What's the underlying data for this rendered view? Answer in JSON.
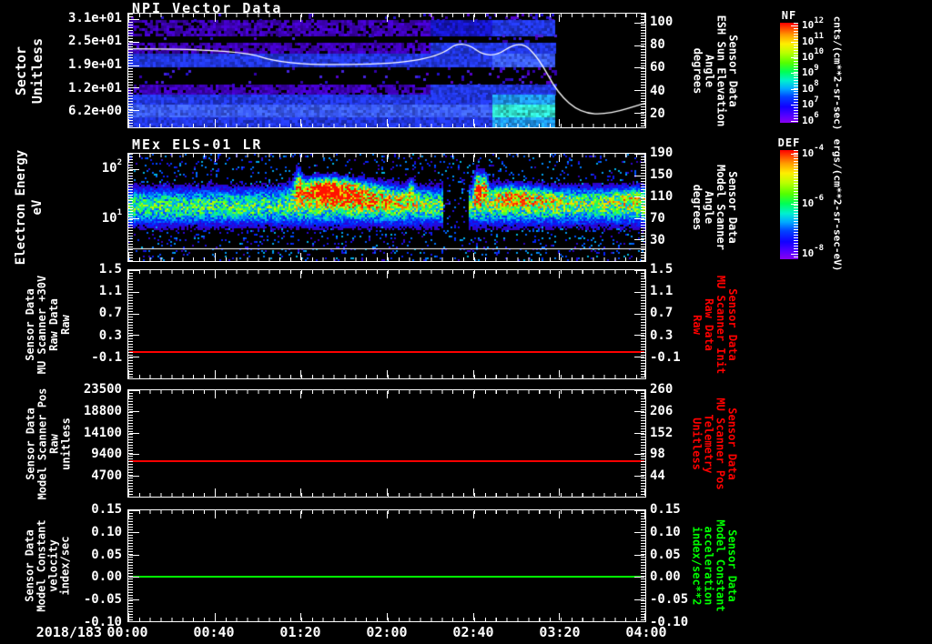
{
  "app": {
    "background": "#000000",
    "text_color": "#ffffff"
  },
  "x_axis": {
    "date_label": "2018/183",
    "tick_labels": [
      "00:00",
      "00:40",
      "01:20",
      "02:00",
      "02:40",
      "03:20",
      "04:00"
    ],
    "minor_ticks_per_major": 8
  },
  "chart_data": {
    "type": "heatmap",
    "description": "Five stacked time-series panels: two spectrograms with colorbars and three constant-value line plots, time axis 2018/183 00:00 to 04:00",
    "panels": [
      {
        "id": "npi",
        "type": "spectrogram",
        "title": "NPI Vector Data",
        "ylabel": "Sector\nUnitless",
        "left_ticks": {
          "labels": [
            "3.1e+01",
            "2.5e+01",
            "1.9e+01",
            "1.2e+01",
            "6.2e+00"
          ],
          "fracs": [
            0.048,
            0.246,
            0.452,
            0.651,
            0.849
          ]
        },
        "right_ticks": {
          "labels": [
            "100",
            "80",
            "60",
            "40",
            "20"
          ],
          "fracs": [
            0.079,
            0.278,
            0.476,
            0.675,
            0.873
          ]
        },
        "right_label": "Sensor Data\nESH Sun Elevation\nAngle\ndegrees",
        "right_label_color": "#ffffff",
        "data_end_frac": 0.825,
        "palette": {
          "purple": "#3c00b4",
          "bdark": "#1515be",
          "blue": "#2136e0",
          "bbright": "#3b5cff",
          "cblue": "#1e96f0",
          "cyan": "#2fd8c4",
          "speck_colors": [
            "#5500cc",
            "#3300aa",
            "#2211cc",
            "#4422dd"
          ]
        },
        "rows": [
          {
            "y0": 0.0,
            "y1": 0.055,
            "segs": [
              [
                "speck",
                0,
                0.825
              ]
            ]
          },
          {
            "y0": 0.055,
            "y1": 0.185,
            "segs": [
              [
                "purple",
                0,
                0.585
              ],
              [
                "bdark",
                0.585,
                0.705
              ],
              [
                "blue",
                0.705,
                0.825
              ]
            ]
          },
          {
            "y0": 0.185,
            "y1": 0.255,
            "segs": [
              [
                "speck",
                0,
                0.825
              ]
            ]
          },
          {
            "y0": 0.255,
            "y1": 0.355,
            "segs": [
              [
                "purple",
                0,
                0.585
              ],
              [
                "blue",
                0.585,
                0.825
              ]
            ]
          },
          {
            "y0": 0.355,
            "y1": 0.475,
            "segs": [
              [
                "blue",
                0,
                0.705
              ],
              [
                "bbright",
                0.705,
                0.825
              ]
            ]
          },
          {
            "y0": 0.475,
            "y1": 0.625,
            "segs": [
              [
                "speck",
                0,
                0.825
              ]
            ]
          },
          {
            "y0": 0.625,
            "y1": 0.715,
            "segs": [
              [
                "purple",
                0,
                0.585
              ],
              [
                "blue",
                0.585,
                0.825
              ]
            ]
          },
          {
            "y0": 0.715,
            "y1": 0.8,
            "segs": [
              [
                "blue",
                0,
                0.705
              ],
              [
                "cblue",
                0.705,
                0.825
              ]
            ]
          },
          {
            "y0": 0.8,
            "y1": 0.915,
            "segs": [
              [
                "bbright",
                0,
                0.705
              ],
              [
                "cyan",
                0.705,
                0.825
              ]
            ]
          },
          {
            "y0": 0.915,
            "y1": 1.0,
            "segs": [
              [
                "blue",
                0,
                0.705
              ],
              [
                "cblue",
                0.705,
                0.825
              ]
            ]
          }
        ],
        "overlay_line": {
          "color": "#ffffff",
          "axis": "right",
          "scale": {
            "v_at_frac0": 108,
            "v_span": 100.5
          },
          "points_xv": [
            [
              0,
              77
            ],
            [
              0.21,
              77
            ],
            [
              0.3,
              63
            ],
            [
              0.5,
              63
            ],
            [
              0.6,
              70
            ],
            [
              0.645,
              85
            ],
            [
              0.7,
              67
            ],
            [
              0.758,
              85
            ],
            [
              0.795,
              68
            ],
            [
              0.83,
              38
            ],
            [
              0.875,
              20
            ],
            [
              0.93,
              19
            ],
            [
              1.0,
              29
            ]
          ]
        },
        "colorbar": {
          "title": "NF",
          "exponents": [
            12,
            11,
            10,
            9,
            8,
            7,
            6
          ],
          "tick_fracs": [
            0.03,
            0.188,
            0.346,
            0.504,
            0.662,
            0.82,
            0.978
          ],
          "units": "cnts/(cm**2-sr-sec)"
        }
      },
      {
        "id": "els",
        "type": "spectrogram",
        "title": "MEx ELS-01 LR",
        "ylabel": "Electron Energy\neV",
        "left_ticks": {
          "labels": [
            "10^2",
            "10^1"
          ],
          "fracs": [
            0.142,
            0.6
          ]
        },
        "right_ticks": {
          "labels": [
            "190",
            "150",
            "110",
            "70",
            "30"
          ],
          "fracs": [
            0.0,
            0.2,
            0.4,
            0.6,
            0.8
          ]
        },
        "right_label": "Sensor Data\nModel Scanner\nAngle\ndegrees",
        "right_label_color": "#ffffff",
        "band": {
          "center": 0.485,
          "hw": 0.16,
          "amp": 0.52
        },
        "speckle_density": 0.1,
        "gap": {
          "x0": 0.607,
          "x1": 0.655
        },
        "hotspots": [
          [
            0.375,
            0.33,
            0.045,
            0.1,
            0.88
          ],
          [
            0.43,
            0.32,
            0.06,
            0.09,
            0.4
          ],
          [
            0.47,
            0.42,
            0.09,
            0.09,
            0.38
          ],
          [
            0.328,
            0.3,
            0.007,
            0.16,
            0.55
          ],
          [
            0.545,
            0.33,
            0.007,
            0.1,
            0.35
          ],
          [
            0.675,
            0.32,
            0.007,
            0.14,
            0.95
          ],
          [
            0.688,
            0.3,
            0.005,
            0.12,
            0.7
          ],
          [
            0.74,
            0.38,
            0.05,
            0.09,
            0.4
          ],
          [
            0.82,
            0.42,
            0.07,
            0.08,
            0.22
          ],
          [
            0.97,
            0.4,
            0.05,
            0.08,
            0.28
          ]
        ],
        "overlay_line": {
          "color": "#ffffff",
          "const_frac": 0.885
        },
        "colorbar": {
          "title": "DEF",
          "exponents": [
            -4,
            -6,
            -8
          ],
          "tick_fracs": [
            0.03,
            0.49,
            0.95
          ],
          "units": "ergs/(cm**2-sr-sec-eV)"
        }
      },
      {
        "id": "mu30v",
        "type": "line",
        "ylabel": "Sensor Data\nMU Scanner +30V\nRaw Data\nRaw",
        "ylim": [
          -0.5,
          1.5
        ],
        "left_ticks": {
          "labels": [
            "1.5",
            "1.1",
            "0.7",
            "0.3",
            "-0.1"
          ],
          "fracs": [
            0.0,
            0.2,
            0.4,
            0.6,
            0.8
          ]
        },
        "right_ticks": {
          "labels": [
            "1.5",
            "1.1",
            "0.7",
            "0.3",
            "-0.1"
          ],
          "fracs": [
            0.0,
            0.2,
            0.4,
            0.6,
            0.8
          ]
        },
        "right_label": "Sensor Data\nMU Scanner Init\nRaw Data\nRaw",
        "right_label_color": "#ff0000",
        "line": {
          "color": "#ff0000",
          "value": 0.0,
          "value_frac": 0.755
        }
      },
      {
        "id": "scanpos",
        "type": "line",
        "ylabel": "Sensor Data\nModel Scanner Pos\nRaw\nunitless",
        "ylim": [
          0,
          23500
        ],
        "left_ticks": {
          "labels": [
            "23500",
            "18800",
            "14100",
            "9400",
            "4700"
          ],
          "fracs": [
            0.0,
            0.2,
            0.4,
            0.6,
            0.8
          ]
        },
        "right_ticks": {
          "labels": [
            "260",
            "206",
            "152",
            "98",
            "44"
          ],
          "fracs": [
            0.0,
            0.2,
            0.4,
            0.6,
            0.8
          ]
        },
        "right_label": "Sensor Data\nMU Scanner Pos\nTelemetry\nUnitless",
        "right_label_color": "#ff0000",
        "line": {
          "color": "#ff0000",
          "value": 7800,
          "value_frac": 0.668
        }
      },
      {
        "id": "velocity",
        "type": "line",
        "ylabel": "Sensor Data\nModel Constant\nvelocity\nindex/sec",
        "ylim": [
          -0.1,
          0.15
        ],
        "left_ticks": {
          "labels": [
            "0.15",
            "0.10",
            "0.05",
            "0.00",
            "-0.05",
            "-0.10"
          ],
          "fracs": [
            0.0,
            0.2,
            0.4,
            0.6,
            0.8,
            1.0
          ]
        },
        "right_ticks": {
          "labels": [
            "0.15",
            "0.10",
            "0.05",
            "0.00",
            "-0.05",
            "-0.10"
          ],
          "fracs": [
            0.0,
            0.2,
            0.4,
            0.6,
            0.8,
            1.0
          ]
        },
        "right_label": "Sensor Data\nModel Constant\nacceleration\nindex/sec**2",
        "right_label_color": "#00ff00",
        "line": {
          "color": "#00ff00",
          "value": 0.0,
          "value_frac": 0.6
        }
      }
    ]
  }
}
